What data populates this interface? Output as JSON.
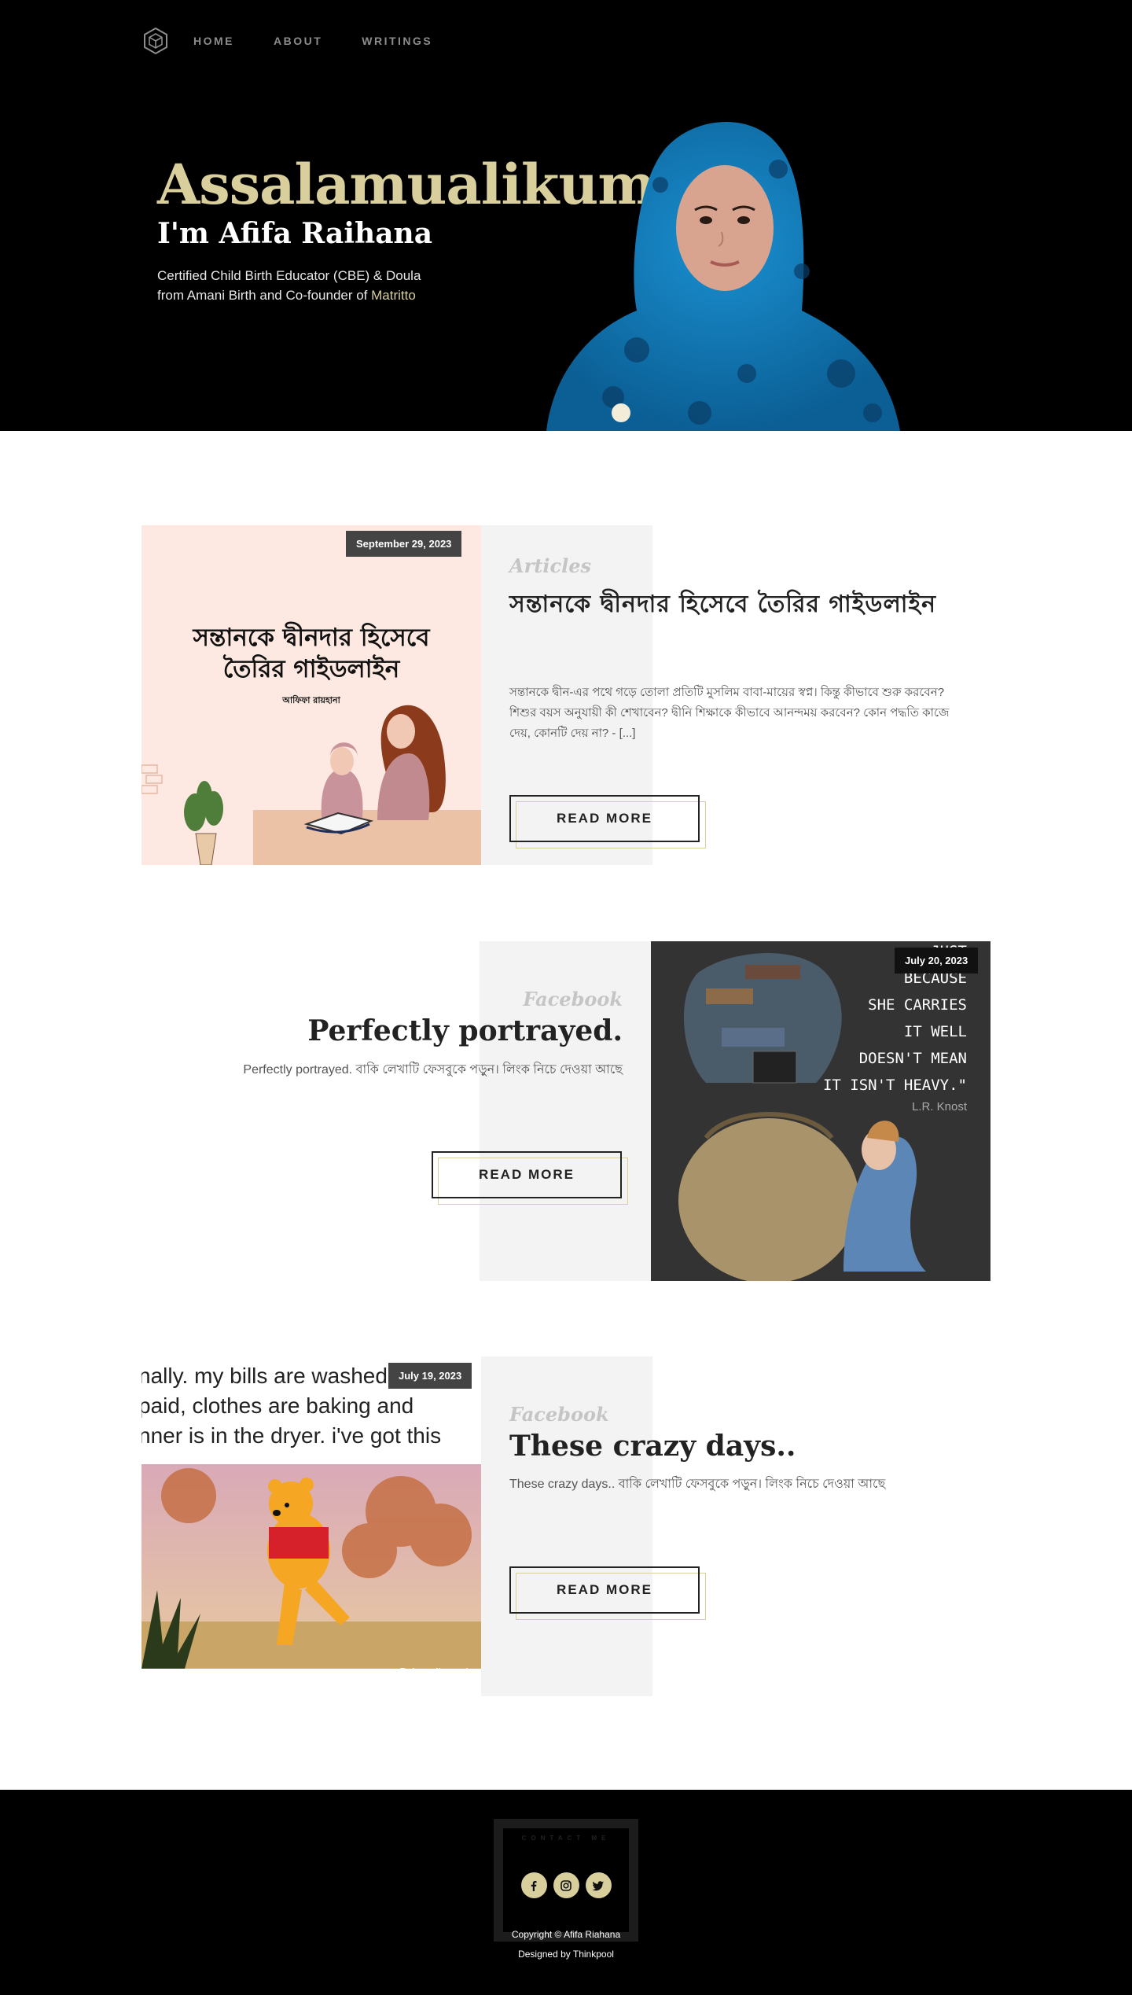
{
  "nav": {
    "items": [
      {
        "label": "HOME"
      },
      {
        "label": "ABOUT"
      },
      {
        "label": "WRITINGS"
      }
    ]
  },
  "hero": {
    "greeting": "Assalamualikum",
    "name": "I'm Afifa Raihana",
    "bio_line1": "Certified Child Birth Educator (CBE) & Doula",
    "bio_line2": "from Amani Birth and Co-founder of ",
    "bio_link": "Matritto"
  },
  "posts": [
    {
      "date": "September 29, 2023",
      "category": "Articles",
      "title": "সন্তানকে দ্বীনদার হিসেবে তৈরির গাইডলাইন",
      "excerpt": "সন্তানকে দ্বীন-এর পথে গড়ে তোলা প্রতিটি মুসলিম বাবা-মায়ের স্বপ্ন। কিন্তু কীভাবে শুরু করবেন? শিশুর বয়স অনুযায়ী কী শেখাবেন? দ্বীনি শিক্ষাকে কীভাবে আনন্দময় করবেন? কোন পদ্ধতি কাজে দেয়, কোনটি দেয় না? - [...]",
      "button": "READ MORE",
      "thumb": {
        "title_line1": "সন্তানকে দ্বীনদার হিসেবে",
        "title_line2": "তৈরির গাইডলাইন",
        "author": "আফিফা রায়হানা"
      }
    },
    {
      "date": "July 20, 2023",
      "category": "Facebook",
      "title": "Perfectly portrayed.",
      "excerpt": "Perfectly portrayed. বাকি লেখাটি ফেসবুকে পড়ুন। লিংক নিচে দেওয়া আছে",
      "button": "READ MORE",
      "thumb": {
        "quote_lines": [
          "JUST",
          "BECAUSE",
          "SHE CARRIES",
          "IT WELL",
          "DOESN'T MEAN",
          "IT ISN'T HEAVY.\""
        ],
        "quote_author": "L.R. Knost"
      }
    },
    {
      "date": "July 19, 2023",
      "category": "Facebook",
      "title": "These crazy days..",
      "excerpt": "These crazy days.. বাকি লেখাটি ফেসবুকে পড়ুন। লিংক নিচে দেওয়া আছে",
      "button": "READ MORE",
      "thumb": {
        "caption_lines": [
          "nally. my bills are washed a",
          "paid, clothes are baking and",
          "nner is in the dryer. i've got this"
        ],
        "watermark": "@deardisneylove"
      }
    }
  ],
  "footer": {
    "contact_label": "CONTACT ME",
    "copyright": "Copyright © Afifa Riahana",
    "designed": "Designed by Thinkpool"
  },
  "colors": {
    "accent": "#d8cf9c",
    "hero_bg": "#000000",
    "block_gray": "#f3f3f3"
  }
}
